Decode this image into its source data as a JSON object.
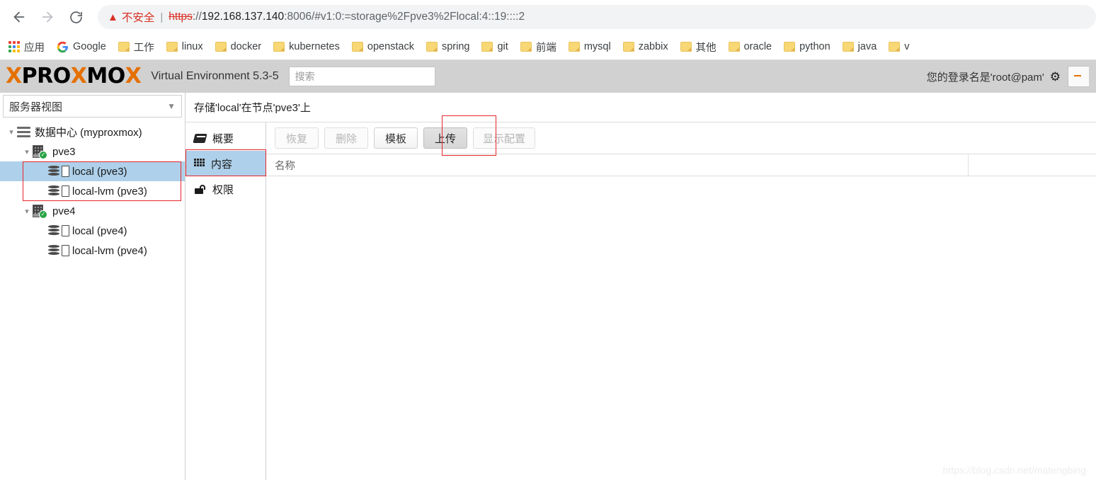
{
  "browser": {
    "nav": {
      "back_icon": "arrow-left-icon",
      "forward_icon": "arrow-right-icon",
      "reload_icon": "reload-icon"
    },
    "omnibox": {
      "warning_icon": "warning-triangle-icon",
      "security_label": "不安全",
      "separator": "|",
      "url_scheme": "https",
      "url_scheme_suffix": "://",
      "url_host": "192.168.137.140",
      "url_rest": ":8006/#v1:0:=storage%2Fpve3%2Flocal:4::19::::2",
      "full_url": "https://192.168.137.140:8006/#v1:0:=storage%2Fpve3%2Flocal:4::19::::2"
    },
    "bookmarks": [
      {
        "label": "应用",
        "icon": "apps-grid-icon"
      },
      {
        "label": "Google",
        "icon": "google-icon"
      },
      {
        "label": "工作",
        "icon": "folder-icon"
      },
      {
        "label": "linux",
        "icon": "folder-icon"
      },
      {
        "label": "docker",
        "icon": "folder-icon"
      },
      {
        "label": "kubernetes",
        "icon": "folder-icon"
      },
      {
        "label": "openstack",
        "icon": "folder-icon"
      },
      {
        "label": "spring",
        "icon": "folder-icon"
      },
      {
        "label": "git",
        "icon": "folder-icon"
      },
      {
        "label": "前端",
        "icon": "folder-icon"
      },
      {
        "label": "mysql",
        "icon": "folder-icon"
      },
      {
        "label": "zabbix",
        "icon": "folder-icon"
      },
      {
        "label": "其他",
        "icon": "folder-icon"
      },
      {
        "label": "oracle",
        "icon": "folder-icon"
      },
      {
        "label": "python",
        "icon": "folder-icon"
      },
      {
        "label": "java",
        "icon": "folder-icon"
      },
      {
        "label": "v",
        "icon": "folder-icon"
      }
    ]
  },
  "pve": {
    "header": {
      "logo_x1": "X",
      "logo_pro": "PRO",
      "logo_x2": "X",
      "logo_mo": "MO",
      "logo_x3": "X",
      "product": "Virtual Environment 5.3-5",
      "search_placeholder": "搜索",
      "search_value": "",
      "username_text": "您的登录名是'root@pam'",
      "gear_icon": "gear-icon"
    },
    "sidebar": {
      "view_selector": "服务器视图",
      "caret_icon": "chevron-down-icon",
      "tree": [
        {
          "label": "数据中心 (myproxmox)",
          "icon": "datacenter-icon",
          "indent": 0,
          "twisty": "expanded",
          "selected": false
        },
        {
          "label": "pve3",
          "icon": "node-online-icon",
          "indent": 1,
          "twisty": "expanded",
          "selected": false
        },
        {
          "label": "local (pve3)",
          "icon": "storage-icon",
          "indent": 2,
          "twisty": "none",
          "selected": true
        },
        {
          "label": "local-lvm (pve3)",
          "icon": "storage-icon",
          "indent": 2,
          "twisty": "none",
          "selected": false
        },
        {
          "label": "pve4",
          "icon": "node-online-icon",
          "indent": 1,
          "twisty": "expanded",
          "selected": false
        },
        {
          "label": "local (pve4)",
          "icon": "storage-icon",
          "indent": 2,
          "twisty": "none",
          "selected": false
        },
        {
          "label": "local-lvm (pve4)",
          "icon": "storage-icon",
          "indent": 2,
          "twisty": "none",
          "selected": false
        }
      ]
    },
    "content": {
      "title": "存储'local'在节点'pve3'上",
      "tabs": [
        {
          "label": "概要",
          "icon": "book-icon",
          "active": false
        },
        {
          "label": "内容",
          "icon": "grid-icon",
          "active": true
        },
        {
          "label": "权限",
          "icon": "unlock-icon",
          "active": false
        }
      ],
      "toolbar": [
        {
          "label": "恢复",
          "state": "disabled"
        },
        {
          "label": "删除",
          "state": "disabled"
        },
        {
          "label": "模板",
          "state": "enabled"
        },
        {
          "label": "上传",
          "state": "pressed"
        },
        {
          "label": "显示配置",
          "state": "disabled"
        }
      ],
      "grid_columns": [
        "名称",
        ""
      ],
      "grid_rows": []
    },
    "watermark": "https://blog.csdn.net/matengbing"
  }
}
